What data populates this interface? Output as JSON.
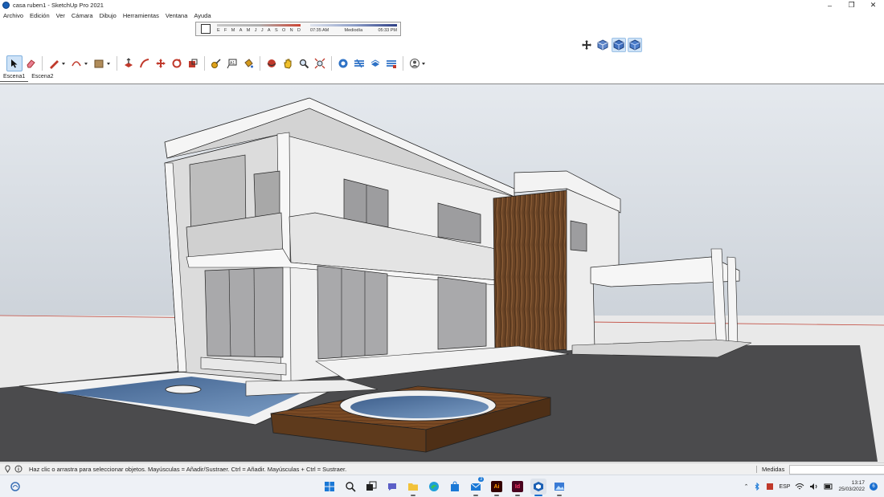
{
  "window": {
    "title": "casa ruben1 - SketchUp Pro 2021",
    "controls": {
      "minimize": "–",
      "maximize": "❐",
      "close": "✕"
    }
  },
  "menu": [
    "Archivo",
    "Edición",
    "Ver",
    "Cámara",
    "Dibujo",
    "Herramientas",
    "Ventana",
    "Ayuda"
  ],
  "shadow_settings": {
    "months": [
      "E",
      "F",
      "M",
      "A",
      "M",
      "J",
      "J",
      "A",
      "S",
      "O",
      "N",
      "D"
    ],
    "time_start": "07:35 AM",
    "time_mid": "Mediodía",
    "time_end": "05:33 PM"
  },
  "toolbar": {
    "tools": [
      {
        "name": "select-tool",
        "icon": "cursor-icon",
        "active": true
      },
      {
        "name": "eraser-tool",
        "icon": "eraser-icon"
      },
      {
        "name": "line-tool",
        "icon": "pencil-icon",
        "dropdown": true
      },
      {
        "name": "arc-tool",
        "icon": "arc-icon",
        "dropdown": true
      },
      {
        "name": "shape-tool",
        "icon": "rectangle-icon",
        "dropdown": true
      },
      {
        "name": "push-pull-tool",
        "icon": "push-pull-icon"
      },
      {
        "name": "follow-me-tool",
        "icon": "follow-me-icon"
      },
      {
        "name": "move-tool",
        "icon": "move-icon"
      },
      {
        "name": "rotate-tool",
        "icon": "rotate-icon"
      },
      {
        "name": "scale-tool",
        "icon": "scale-icon"
      },
      {
        "name": "tape-measure-tool",
        "icon": "tape-measure-icon"
      },
      {
        "name": "text-tool",
        "icon": "text-icon"
      },
      {
        "name": "paint-bucket-tool",
        "icon": "paint-bucket-icon"
      },
      {
        "name": "orbit-tool",
        "icon": "orbit-icon"
      },
      {
        "name": "pan-tool",
        "icon": "hand-icon"
      },
      {
        "name": "zoom-tool",
        "icon": "zoom-icon"
      },
      {
        "name": "zoom-extents-tool",
        "icon": "zoom-extents-icon"
      },
      {
        "name": "warehouse-tool",
        "icon": "warehouse-icon"
      },
      {
        "name": "extension-warehouse-tool",
        "icon": "extension-warehouse-icon"
      },
      {
        "name": "layout-tool",
        "icon": "layout-icon"
      },
      {
        "name": "extension-manager-tool",
        "icon": "extension-manager-icon"
      },
      {
        "name": "account-tool",
        "icon": "user-icon",
        "dropdown": true
      }
    ]
  },
  "scenes": [
    {
      "label": "Escena1",
      "active": true
    },
    {
      "label": "Escena2",
      "active": false
    }
  ],
  "status": {
    "message": "Haz clic o arrastra para seleccionar objetos. Mayúsculas = Añadir/Sustraer. Ctrl = Añadir. Mayúsculas + Ctrl = Sustraer.",
    "measures_label": "Medidas",
    "measures_value": ""
  },
  "taskbar": {
    "apps": [
      {
        "name": "windows-start",
        "icon": "windows-icon"
      },
      {
        "name": "search",
        "icon": "search-icon"
      },
      {
        "name": "task-view",
        "icon": "task-view-icon"
      },
      {
        "name": "chat",
        "icon": "chat-icon"
      },
      {
        "name": "file-explorer",
        "icon": "folder-icon"
      },
      {
        "name": "edge",
        "icon": "edge-icon"
      },
      {
        "name": "store",
        "icon": "store-icon"
      },
      {
        "name": "mail",
        "icon": "mail-icon",
        "badge": "3"
      },
      {
        "name": "illustrator",
        "icon": "illustrator-icon",
        "text": "Ai"
      },
      {
        "name": "indesign",
        "icon": "indesign-icon",
        "text": "Id"
      },
      {
        "name": "sketchup",
        "icon": "sketchup-icon",
        "active": true
      },
      {
        "name": "photos",
        "icon": "photos-icon"
      }
    ],
    "language": "ESP",
    "time": "13:17",
    "date": "25/03/2022",
    "notifications": "6"
  },
  "colors": {
    "sky": "#d8dde4",
    "ground": "#4b4b4d",
    "horizon_line": "#c24a3e",
    "wall_white": "#ededed",
    "wall_shade": "#cfcfcf",
    "glass": "#a9a9ab",
    "wood": "#6b4628",
    "water": "#5d7fa8",
    "accent": "#1a6fd0"
  }
}
